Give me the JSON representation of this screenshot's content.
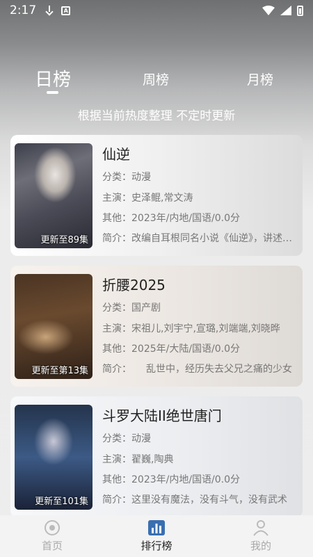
{
  "status": {
    "time": "2:17"
  },
  "tabs": [
    {
      "label": "日榜",
      "active": true
    },
    {
      "label": "周榜",
      "active": false
    },
    {
      "label": "月榜",
      "active": false
    }
  ],
  "subtitle": "根据当前热度整理 不定时更新",
  "cards": [
    {
      "title": "仙逆",
      "badge": "更新至89集",
      "category": "分类：动漫",
      "cast": "主演：史泽鲲,常文涛",
      "other": "其他：2023年/内地/国语/0.0分",
      "intro": "简介：改编自耳根同名小说《仙逆》，讲述了乡村平凡少年王林以心中之执，逆仙而修，求的不仅是长生"
    },
    {
      "title": "折腰2025",
      "badge": "更新至第13集",
      "category": "分类：国产剧",
      "cast": "主演：宋祖儿,刘宇宁,宣璐,刘端端,刘晓晔",
      "other": "其他：2025年/大陆/国语/0.0分",
      "intro": "简介：　　乱世中，经历失去父兄之痛的少女"
    },
    {
      "title": "斗罗大陆II绝世唐门",
      "badge": "更新至101集",
      "category": "分类：动漫",
      "cast": "主演：翟巍,陶典",
      "other": "其他：2023年/内地/国语/0.0分",
      "intro": "简介：这里没有魔法，没有斗气，没有武术"
    }
  ],
  "nav": {
    "home": "首页",
    "ranking": "排行榜",
    "mine": "我的"
  },
  "colors": {
    "active_nav": "#222222",
    "inactive_nav": "#aaaaaa"
  }
}
